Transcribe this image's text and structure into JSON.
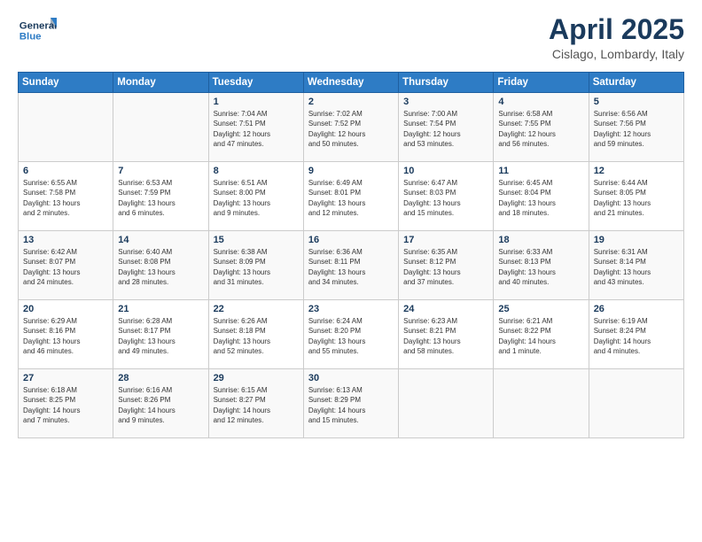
{
  "logo": {
    "line1": "General",
    "line2": "Blue"
  },
  "header": {
    "title": "April 2025",
    "subtitle": "Cislago, Lombardy, Italy"
  },
  "days_of_week": [
    "Sunday",
    "Monday",
    "Tuesday",
    "Wednesday",
    "Thursday",
    "Friday",
    "Saturday"
  ],
  "weeks": [
    [
      {
        "day": "",
        "info": ""
      },
      {
        "day": "",
        "info": ""
      },
      {
        "day": "1",
        "info": "Sunrise: 7:04 AM\nSunset: 7:51 PM\nDaylight: 12 hours\nand 47 minutes."
      },
      {
        "day": "2",
        "info": "Sunrise: 7:02 AM\nSunset: 7:52 PM\nDaylight: 12 hours\nand 50 minutes."
      },
      {
        "day": "3",
        "info": "Sunrise: 7:00 AM\nSunset: 7:54 PM\nDaylight: 12 hours\nand 53 minutes."
      },
      {
        "day": "4",
        "info": "Sunrise: 6:58 AM\nSunset: 7:55 PM\nDaylight: 12 hours\nand 56 minutes."
      },
      {
        "day": "5",
        "info": "Sunrise: 6:56 AM\nSunset: 7:56 PM\nDaylight: 12 hours\nand 59 minutes."
      }
    ],
    [
      {
        "day": "6",
        "info": "Sunrise: 6:55 AM\nSunset: 7:58 PM\nDaylight: 13 hours\nand 2 minutes."
      },
      {
        "day": "7",
        "info": "Sunrise: 6:53 AM\nSunset: 7:59 PM\nDaylight: 13 hours\nand 6 minutes."
      },
      {
        "day": "8",
        "info": "Sunrise: 6:51 AM\nSunset: 8:00 PM\nDaylight: 13 hours\nand 9 minutes."
      },
      {
        "day": "9",
        "info": "Sunrise: 6:49 AM\nSunset: 8:01 PM\nDaylight: 13 hours\nand 12 minutes."
      },
      {
        "day": "10",
        "info": "Sunrise: 6:47 AM\nSunset: 8:03 PM\nDaylight: 13 hours\nand 15 minutes."
      },
      {
        "day": "11",
        "info": "Sunrise: 6:45 AM\nSunset: 8:04 PM\nDaylight: 13 hours\nand 18 minutes."
      },
      {
        "day": "12",
        "info": "Sunrise: 6:44 AM\nSunset: 8:05 PM\nDaylight: 13 hours\nand 21 minutes."
      }
    ],
    [
      {
        "day": "13",
        "info": "Sunrise: 6:42 AM\nSunset: 8:07 PM\nDaylight: 13 hours\nand 24 minutes."
      },
      {
        "day": "14",
        "info": "Sunrise: 6:40 AM\nSunset: 8:08 PM\nDaylight: 13 hours\nand 28 minutes."
      },
      {
        "day": "15",
        "info": "Sunrise: 6:38 AM\nSunset: 8:09 PM\nDaylight: 13 hours\nand 31 minutes."
      },
      {
        "day": "16",
        "info": "Sunrise: 6:36 AM\nSunset: 8:11 PM\nDaylight: 13 hours\nand 34 minutes."
      },
      {
        "day": "17",
        "info": "Sunrise: 6:35 AM\nSunset: 8:12 PM\nDaylight: 13 hours\nand 37 minutes."
      },
      {
        "day": "18",
        "info": "Sunrise: 6:33 AM\nSunset: 8:13 PM\nDaylight: 13 hours\nand 40 minutes."
      },
      {
        "day": "19",
        "info": "Sunrise: 6:31 AM\nSunset: 8:14 PM\nDaylight: 13 hours\nand 43 minutes."
      }
    ],
    [
      {
        "day": "20",
        "info": "Sunrise: 6:29 AM\nSunset: 8:16 PM\nDaylight: 13 hours\nand 46 minutes."
      },
      {
        "day": "21",
        "info": "Sunrise: 6:28 AM\nSunset: 8:17 PM\nDaylight: 13 hours\nand 49 minutes."
      },
      {
        "day": "22",
        "info": "Sunrise: 6:26 AM\nSunset: 8:18 PM\nDaylight: 13 hours\nand 52 minutes."
      },
      {
        "day": "23",
        "info": "Sunrise: 6:24 AM\nSunset: 8:20 PM\nDaylight: 13 hours\nand 55 minutes."
      },
      {
        "day": "24",
        "info": "Sunrise: 6:23 AM\nSunset: 8:21 PM\nDaylight: 13 hours\nand 58 minutes."
      },
      {
        "day": "25",
        "info": "Sunrise: 6:21 AM\nSunset: 8:22 PM\nDaylight: 14 hours\nand 1 minute."
      },
      {
        "day": "26",
        "info": "Sunrise: 6:19 AM\nSunset: 8:24 PM\nDaylight: 14 hours\nand 4 minutes."
      }
    ],
    [
      {
        "day": "27",
        "info": "Sunrise: 6:18 AM\nSunset: 8:25 PM\nDaylight: 14 hours\nand 7 minutes."
      },
      {
        "day": "28",
        "info": "Sunrise: 6:16 AM\nSunset: 8:26 PM\nDaylight: 14 hours\nand 9 minutes."
      },
      {
        "day": "29",
        "info": "Sunrise: 6:15 AM\nSunset: 8:27 PM\nDaylight: 14 hours\nand 12 minutes."
      },
      {
        "day": "30",
        "info": "Sunrise: 6:13 AM\nSunset: 8:29 PM\nDaylight: 14 hours\nand 15 minutes."
      },
      {
        "day": "",
        "info": ""
      },
      {
        "day": "",
        "info": ""
      },
      {
        "day": "",
        "info": ""
      }
    ]
  ]
}
